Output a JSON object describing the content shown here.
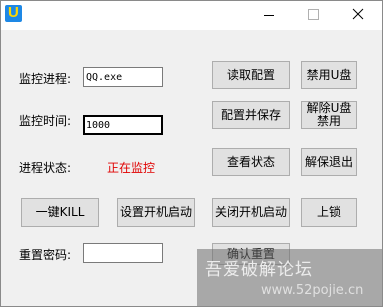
{
  "app": {
    "icon_letter": "U"
  },
  "fields": {
    "process_label": "监控进程:",
    "process_value": "QQ.exe",
    "time_label": "监控时间:",
    "time_value": "1000",
    "status_label": "进程状态:",
    "status_value": "正在监控",
    "reset_pw_label": "重置密码:",
    "reset_pw_value": ""
  },
  "buttons": {
    "read_config": "读取配置",
    "disable_usb": "禁用U盘",
    "save_config": "配置并保存",
    "undo_usb_line1": "解除U盘",
    "undo_usb_line2": "禁用",
    "check_status": "查看状态",
    "unprotect_exit": "解保退出",
    "kill": "一键KILL",
    "set_autostart": "设置开机启动",
    "disable_autostart": "关闭开机启动",
    "lock": "上锁",
    "confirm_reset": "确认重置"
  },
  "watermark": {
    "title": "吾爱破解论坛",
    "url": "www.52pojie.cn"
  },
  "colors": {
    "status_active": "#e00000",
    "icon_bg": "#1e88e5",
    "icon_fg": "#ffd600"
  }
}
